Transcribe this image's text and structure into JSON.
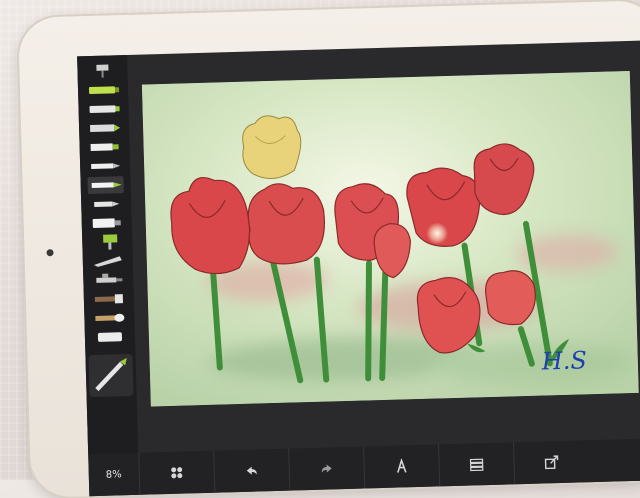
{
  "app": {
    "zoom_level": "8%",
    "signature": "H.S"
  },
  "colors": {
    "canvas_bg": "#cfe0c4",
    "tulip_red": "#d9474a",
    "tulip_yellow": "#e8d27a",
    "stem_green": "#3f8f3a",
    "signature_blue": "#1d3fb0"
  },
  "toolbar": {
    "brushes": [
      "paint-roller-icon",
      "marker-green-icon",
      "marker-icon",
      "crayon-icon",
      "felt-pen-icon",
      "pen-icon",
      "pencil-icon",
      "pencil-short-icon",
      "paint-tube-icon",
      "roller-icon",
      "palette-knife-icon",
      "airbrush-icon",
      "brush-flat-icon",
      "brush-round-icon",
      "eraser-icon"
    ],
    "active_tool": "brush-large-icon"
  },
  "bottombar": {
    "items": [
      "settings-icon",
      "undo-icon",
      "redo-icon",
      "symmetry-icon",
      "layers-icon",
      "export-icon"
    ]
  }
}
